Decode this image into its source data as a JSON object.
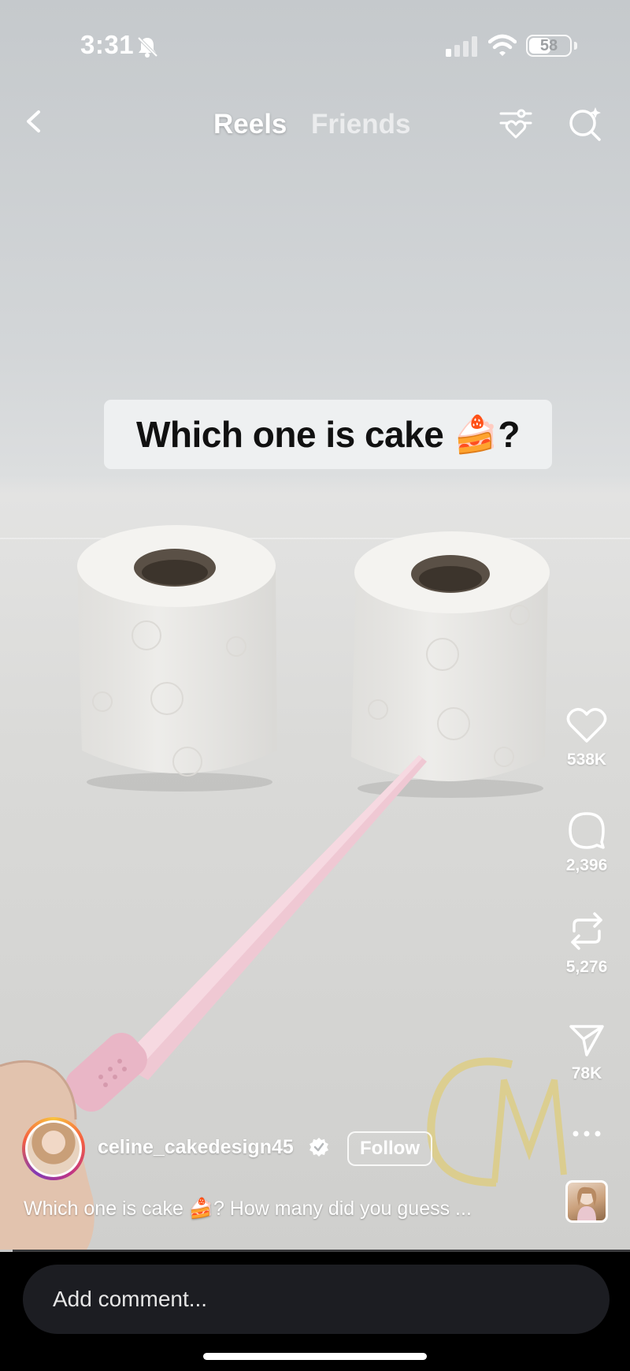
{
  "status_bar": {
    "time": "3:31",
    "battery": "58",
    "battery_level": 0.58,
    "icons": [
      "bell-slash-icon",
      "cellular-signal-icon",
      "wifi-icon",
      "battery-icon"
    ]
  },
  "header": {
    "tabs": [
      {
        "label": "Reels",
        "active": true
      },
      {
        "label": "Friends",
        "active": false
      }
    ],
    "icons": [
      "back-chevron-icon",
      "filter-heart-icon",
      "search-sparkle-icon"
    ]
  },
  "video": {
    "overlay_text": "Which one is cake 🍰?"
  },
  "actions": {
    "likes": "538K",
    "comments": "2,396",
    "reposts": "5,276",
    "shares": "78K",
    "icons": [
      "heart-icon",
      "comment-icon",
      "repost-icon",
      "send-icon",
      "more-icon"
    ]
  },
  "author": {
    "username": "celine_cakedesign45",
    "follow_label": "Follow",
    "caption": "Which one is cake 🍰? How many did you guess ..."
  },
  "progress": 0.02,
  "comment": {
    "placeholder": "Add comment..."
  },
  "colors": {
    "background": "#000000",
    "comment_bar": "#1c1d22",
    "video_wall": "#d3d6d8"
  }
}
